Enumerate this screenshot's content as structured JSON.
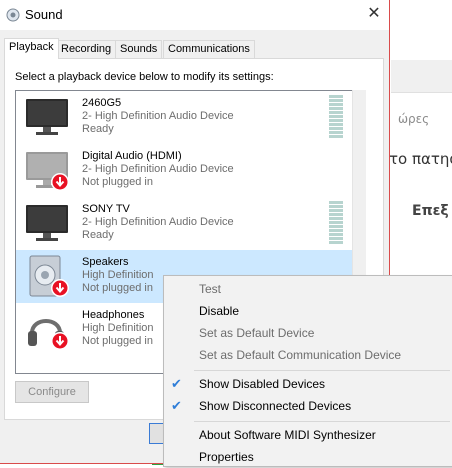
{
  "background_app": {
    "text_1": "ώρες",
    "text_2": "το πατησ",
    "text_3": "Επεξ"
  },
  "dialog": {
    "title": "Sound",
    "close_label": "✕",
    "tabs": [
      {
        "label": "Playback"
      },
      {
        "label": "Recording"
      },
      {
        "label": "Sounds"
      },
      {
        "label": "Communications"
      }
    ],
    "instruction": "Select a playback device below to modify its settings:",
    "devices": [
      {
        "name": "2460G5",
        "line2": "2- High Definition Audio Device",
        "status": "Ready",
        "icon": "monitor-icon"
      },
      {
        "name": "Digital Audio (HDMI)",
        "line2": "2- High Definition Audio Device",
        "status": "Not plugged in",
        "icon": "monitor-disabled-icon"
      },
      {
        "name": "SONY TV",
        "line2": "2- High Definition Audio Device",
        "status": "Ready",
        "icon": "monitor-icon"
      },
      {
        "name": "Speakers",
        "line2": "High Definition",
        "status": "Not plugged in",
        "icon": "speaker-icon"
      },
      {
        "name": "Headphones",
        "line2": "High Definition",
        "status": "Not plugged in",
        "icon": "headphones-icon"
      }
    ],
    "configure_label": "Configure"
  },
  "context_menu": {
    "items": [
      {
        "label": "Test",
        "enabled": false,
        "checked": false
      },
      {
        "label": "Disable",
        "enabled": true,
        "checked": false
      },
      {
        "label": "Set as Default Device",
        "enabled": false,
        "checked": false
      },
      {
        "label": "Set as Default Communication Device",
        "enabled": false,
        "checked": false
      },
      {
        "label": "Show Disabled Devices",
        "enabled": true,
        "checked": true
      },
      {
        "label": "Show Disconnected Devices",
        "enabled": true,
        "checked": true
      },
      {
        "label": "About Software MIDI Synthesizer",
        "enabled": true,
        "checked": false
      },
      {
        "label": "Properties",
        "enabled": true,
        "checked": false
      }
    ],
    "check_glyph": "✔"
  },
  "colors": {
    "accent": "#2f7ed8",
    "selection": "#cce8ff",
    "dialog_border": "#d94b4b",
    "status_red": "#e81123"
  }
}
